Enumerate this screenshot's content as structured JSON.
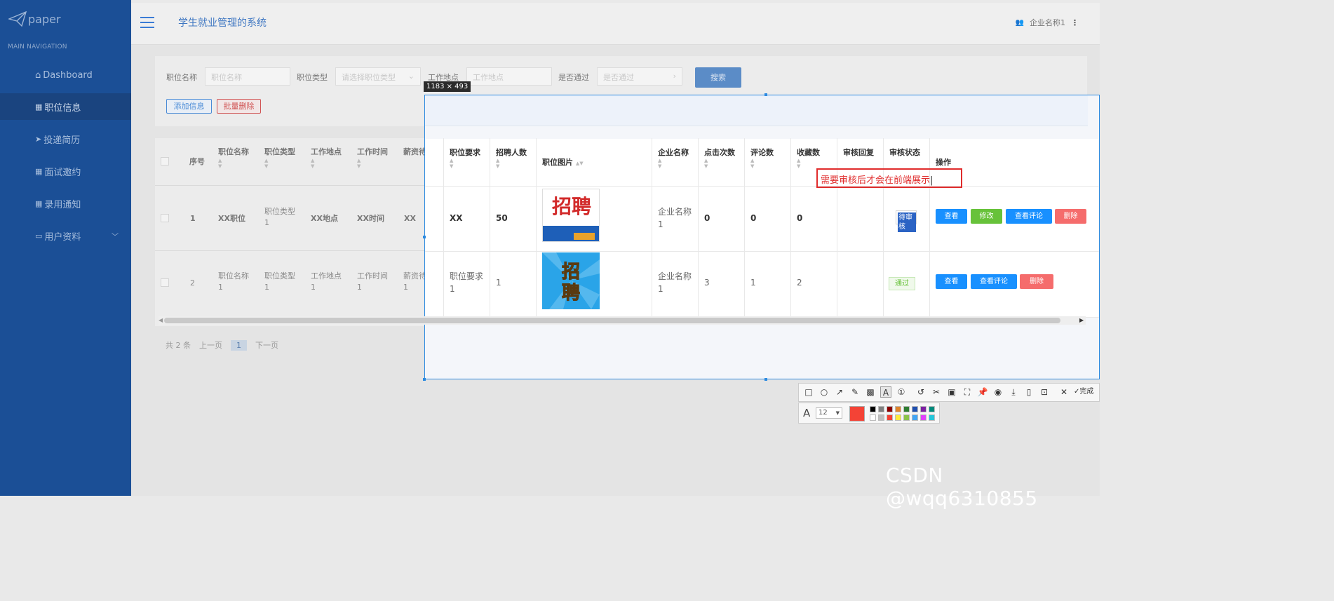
{
  "app": {
    "logo_text": "paper",
    "system_title": "学生就业管理的系统",
    "user_name": "企业名称1"
  },
  "sidebar": {
    "nav_title": "MAIN NAVIGATION",
    "items": [
      {
        "label": "Dashboard",
        "icon": "home-icon"
      },
      {
        "label": "职位信息",
        "icon": "grid-icon",
        "active": true
      },
      {
        "label": "投递简历",
        "icon": "send-icon"
      },
      {
        "label": "面试邀约",
        "icon": "grid-icon"
      },
      {
        "label": "录用通知",
        "icon": "grid-icon"
      },
      {
        "label": "用户资料",
        "icon": "card-icon"
      }
    ]
  },
  "search": {
    "job_name_label": "职位名称",
    "job_name_placeholder": "职位名称",
    "job_type_label": "职位类型",
    "job_type_placeholder": "请选择职位类型",
    "location_label": "工作地点",
    "location_placeholder": "工作地点",
    "approved_label": "是否通过",
    "approved_placeholder": "是否通过",
    "search_button": "搜索",
    "add_button": "添加信息",
    "batch_delete_button": "批量删除"
  },
  "table": {
    "headers": [
      "序号",
      "职位名称",
      "职位类型",
      "工作地点",
      "工作时间",
      "薪资待遇",
      "职位要求",
      "招聘人数",
      "职位图片",
      "企业名称",
      "点击次数",
      "评论数",
      "收藏数",
      "审核回复",
      "审核状态",
      "操作"
    ],
    "rows": [
      {
        "index": "1",
        "name": "XX职位",
        "type_line1": "职位类型",
        "type_line2": "1",
        "location": "XX地点",
        "time": "XX时间",
        "salary": "XX",
        "requirement": "XX",
        "count": "50",
        "company_line1": "企业名称",
        "company_line2": "1",
        "clicks": "0",
        "comments": "0",
        "favorites": "0",
        "reply": "",
        "status": "待审核",
        "actions": [
          "查看",
          "修改",
          "查看评论",
          "删除"
        ],
        "image_text": "招聘"
      },
      {
        "index": "2",
        "name_line1": "职位名称",
        "name_line2": "1",
        "type_line1": "职位类型",
        "type_line2": "1",
        "location_line1": "工作地点",
        "location_line2": "1",
        "time_line1": "工作时间",
        "time_line2": "1",
        "salary_line1": "薪资待遇",
        "salary_line2": "1",
        "requirement_line1": "职位要求",
        "requirement_line2": "1",
        "count": "1",
        "company_line1": "企业名称",
        "company_line2": "1",
        "clicks": "3",
        "comments": "1",
        "favorites": "2",
        "reply": "",
        "status": "通过",
        "actions": [
          "查看",
          "查看评论",
          "删除"
        ],
        "image_text": "招聘"
      }
    ]
  },
  "pager": {
    "total": "共 2 条",
    "prev": "上一页",
    "current": "1",
    "next": "下一页"
  },
  "screenshot_tool": {
    "size_label": "1183 × 493",
    "annotation_text": "需要审核后才会在前端展示",
    "font_size": "12",
    "done_label": "完成",
    "current_color": "#f44336"
  },
  "watermark": "CSDN @wqq6310855"
}
